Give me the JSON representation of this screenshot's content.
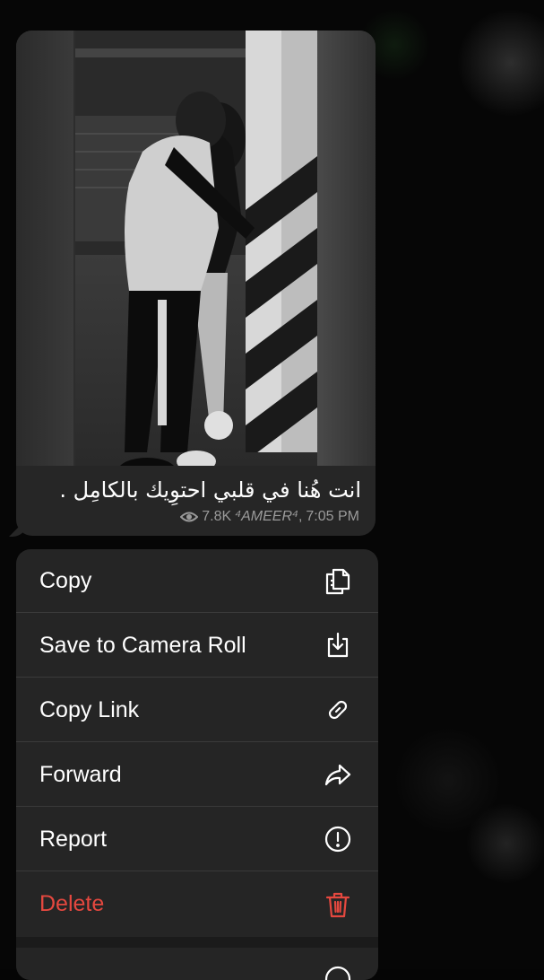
{
  "message": {
    "caption": "انت هُنا في قلبي احتوِيك بالكامِل .",
    "views": "7.8K",
    "author": "⁴AMEER⁴",
    "time": "7:05 PM",
    "meta_separator": ","
  },
  "context_menu": {
    "items": [
      {
        "label": "Copy",
        "icon": "copy-icon"
      },
      {
        "label": "Save to Camera Roll",
        "icon": "download-icon"
      },
      {
        "label": "Copy Link",
        "icon": "link-icon"
      },
      {
        "label": "Forward",
        "icon": "forward-icon"
      },
      {
        "label": "Report",
        "icon": "report-icon"
      },
      {
        "label": "Delete",
        "icon": "trash-icon"
      }
    ]
  },
  "colors": {
    "menu_background": "#252525",
    "bubble_background": "#262626",
    "danger": "#e5483f",
    "meta_text": "#9a9a9a"
  }
}
